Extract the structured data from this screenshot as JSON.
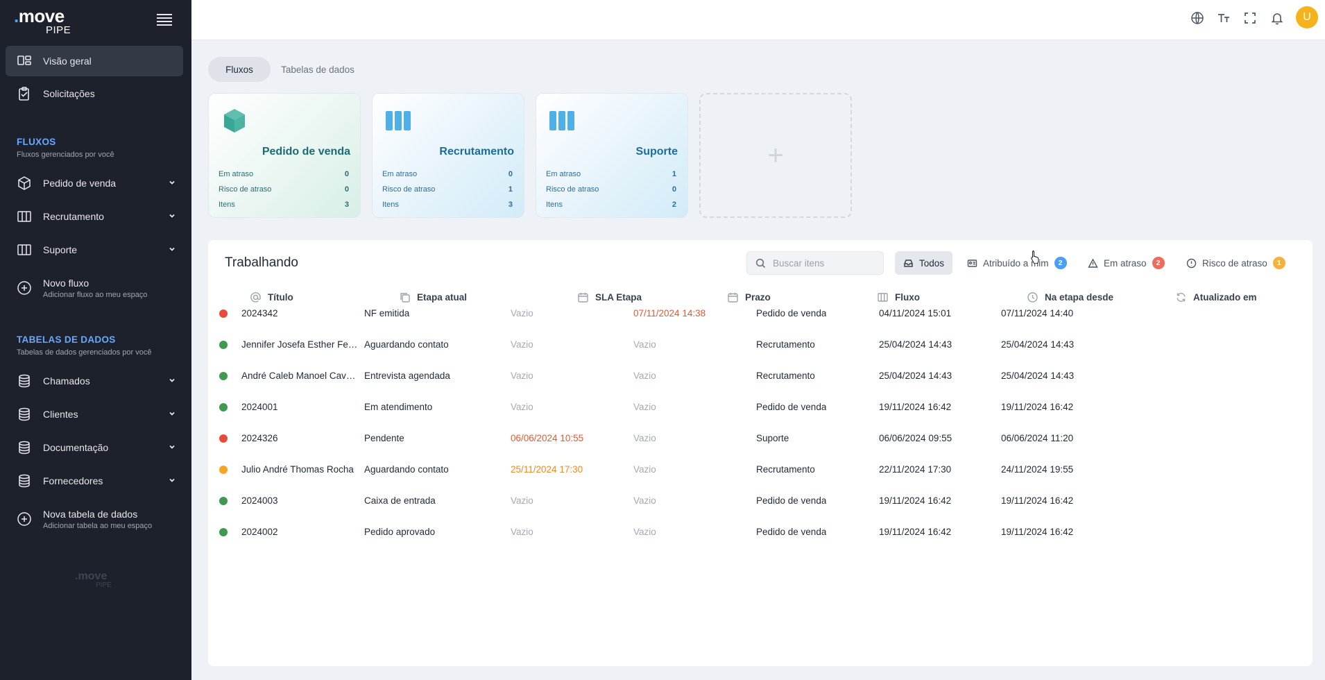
{
  "brand": {
    "logo_main": "move",
    "logo_sub": "PIPE",
    "logo_dot": "."
  },
  "sidebar": {
    "main_items": [
      {
        "label": "Visão geral",
        "icon": "dashboard-icon",
        "active": true
      },
      {
        "label": "Solicitações",
        "icon": "clipboard-icon",
        "active": false
      }
    ],
    "flows_section": {
      "title": "FLUXOS",
      "subtitle": "Fluxos gerenciados por você"
    },
    "flows": [
      {
        "label": "Pedido de venda",
        "icon": "cube-icon"
      },
      {
        "label": "Recrutamento",
        "icon": "columns-icon"
      },
      {
        "label": "Suporte",
        "icon": "columns-icon"
      }
    ],
    "new_flow": {
      "label": "Novo fluxo",
      "sub": "Adicionar fluxo ao meu espaço"
    },
    "tables_section": {
      "title": "TABELAS DE DADOS",
      "subtitle": "Tabelas de dados gerenciados por você"
    },
    "tables": [
      {
        "label": "Chamados",
        "icon": "database-icon"
      },
      {
        "label": "Clientes",
        "icon": "database-icon"
      },
      {
        "label": "Documentação",
        "icon": "database-icon"
      },
      {
        "label": "Fornecedores",
        "icon": "database-icon"
      }
    ],
    "new_table": {
      "label": "Nova tabela de dados",
      "sub": "Adicionar tabela ao meu espaço"
    }
  },
  "topbar": {
    "icons": [
      "globe-icon",
      "text-size-icon",
      "fullscreen-icon",
      "bell-icon"
    ],
    "avatar": "U"
  },
  "tabs": [
    {
      "label": "Fluxos",
      "active": true
    },
    {
      "label": "Tabelas de dados",
      "active": false
    }
  ],
  "flow_cards": [
    {
      "title": "Pedido de venda",
      "theme": "green",
      "icon": "cube-icon",
      "stats": [
        {
          "label": "Em atraso",
          "value": "0"
        },
        {
          "label": "Risco de atraso",
          "value": "0"
        },
        {
          "label": "Itens",
          "value": "3"
        }
      ]
    },
    {
      "title": "Recrutamento",
      "theme": "blue",
      "icon": "columns-icon",
      "stats": [
        {
          "label": "Em atraso",
          "value": "0"
        },
        {
          "label": "Risco de atraso",
          "value": "1"
        },
        {
          "label": "Itens",
          "value": "3"
        }
      ]
    },
    {
      "title": "Suporte",
      "theme": "blue",
      "icon": "columns-icon",
      "stats": [
        {
          "label": "Em atraso",
          "value": "1"
        },
        {
          "label": "Risco de atraso",
          "value": "0"
        },
        {
          "label": "Itens",
          "value": "2"
        }
      ]
    }
  ],
  "add_card": {
    "symbol": "+"
  },
  "working": {
    "title": "Trabalhando",
    "search_placeholder": "Buscar itens",
    "filters": [
      {
        "label": "Todos",
        "active": true,
        "icon": "tray-icon"
      },
      {
        "label": "Atribuído a mim",
        "active": false,
        "icon": "id-card-icon",
        "badge": "2",
        "badge_color": "#4a9ff5"
      },
      {
        "label": "Em atraso",
        "active": false,
        "icon": "warning-icon",
        "badge": "2",
        "badge_color": "#ef6b5b"
      },
      {
        "label": "Risco de atraso",
        "active": false,
        "icon": "alert-circle-icon",
        "badge": "1",
        "badge_color": "#f5b23b"
      }
    ],
    "columns": [
      {
        "label": "Título",
        "icon": "at-icon"
      },
      {
        "label": "Etapa atual",
        "icon": "copy-icon"
      },
      {
        "label": "SLA Etapa",
        "icon": "calendar-icon"
      },
      {
        "label": "Prazo",
        "icon": "calendar-icon"
      },
      {
        "label": "Fluxo",
        "icon": "columns-icon"
      },
      {
        "label": "Na etapa desde",
        "icon": "clock-icon"
      },
      {
        "label": "Atualizado em",
        "icon": "refresh-icon"
      }
    ],
    "rows": [
      {
        "status": "red",
        "title": "2024342",
        "stage": "NF emitida",
        "sla": "Vazio",
        "sla_state": "empty",
        "deadline": "07/11/2024 14:38",
        "deadline_state": "late",
        "flow": "Pedido de venda",
        "since": "04/11/2024 15:01",
        "updated": "07/11/2024 14:40"
      },
      {
        "status": "green",
        "title": "Jennifer Josefa Esther Fern...",
        "stage": "Aguardando contato",
        "sla": "Vazio",
        "sla_state": "empty",
        "deadline": "Vazio",
        "deadline_state": "empty",
        "flow": "Recrutamento",
        "since": "25/04/2024 14:43",
        "updated": "25/04/2024 14:43"
      },
      {
        "status": "green",
        "title": "André Caleb Manoel Caval...",
        "stage": "Entrevista agendada",
        "sla": "Vazio",
        "sla_state": "empty",
        "deadline": "Vazio",
        "deadline_state": "empty",
        "flow": "Recrutamento",
        "since": "25/04/2024 14:43",
        "updated": "25/04/2024 14:43"
      },
      {
        "status": "green",
        "title": "2024001",
        "stage": "Em atendimento",
        "sla": "Vazio",
        "sla_state": "empty",
        "deadline": "Vazio",
        "deadline_state": "empty",
        "flow": "Pedido de venda",
        "since": "19/11/2024 16:42",
        "updated": "19/11/2024 16:42"
      },
      {
        "status": "red",
        "title": "2024326",
        "stage": "Pendente",
        "sla": "06/06/2024 10:55",
        "sla_state": "late",
        "deadline": "Vazio",
        "deadline_state": "empty",
        "flow": "Suporte",
        "since": "06/06/2024 09:55",
        "updated": "06/06/2024 11:20"
      },
      {
        "status": "orange",
        "title": "Julio André Thomas Rocha",
        "stage": "Aguardando contato",
        "sla": "25/11/2024 17:30",
        "sla_state": "risk",
        "deadline": "Vazio",
        "deadline_state": "empty",
        "flow": "Recrutamento",
        "since": "22/11/2024 17:30",
        "updated": "24/11/2024 19:55"
      },
      {
        "status": "green",
        "title": "2024003",
        "stage": "Caixa de entrada",
        "sla": "Vazio",
        "sla_state": "empty",
        "deadline": "Vazio",
        "deadline_state": "empty",
        "flow": "Pedido de venda",
        "since": "19/11/2024 16:42",
        "updated": "19/11/2024 16:42"
      },
      {
        "status": "green",
        "title": "2024002",
        "stage": "Pedido aprovado",
        "sla": "Vazio",
        "sla_state": "empty",
        "deadline": "Vazio",
        "deadline_state": "empty",
        "flow": "Pedido de venda",
        "since": "19/11/2024 16:42",
        "updated": "19/11/2024 16:42"
      }
    ]
  },
  "colors": {
    "status_red": "#ea4a3b",
    "status_green": "#3e9a4f",
    "status_orange": "#f5a524",
    "late_text": "#e8572e",
    "risk_text": "#ef8a1f",
    "accent": "#6aa8ff"
  }
}
